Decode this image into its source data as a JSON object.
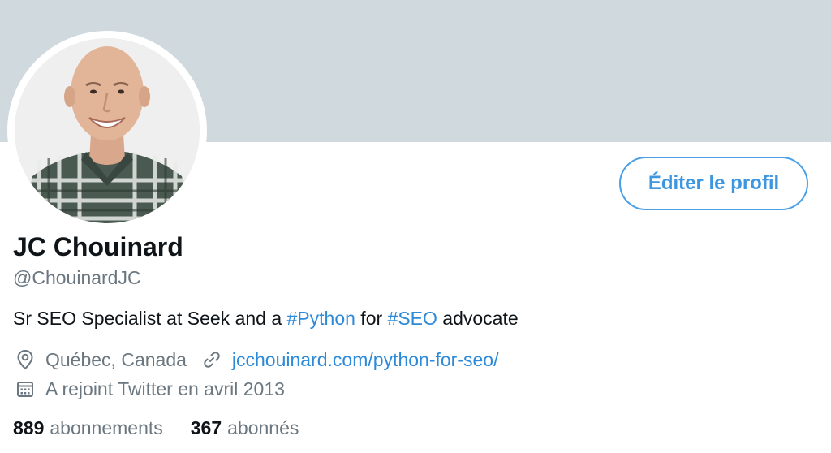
{
  "profile": {
    "name": "JC Chouinard",
    "handle": "@ChouinardJC",
    "edit_button_label": "Éditer le profil",
    "bio": {
      "part1": "Sr SEO Specialist at Seek and a ",
      "hashtag1": "#Python",
      "part2": " for ",
      "hashtag2": "#SEO",
      "part3": " advocate"
    },
    "location": "Québec, Canada",
    "website": "jcchouinard.com/python-for-seo/",
    "joined": "A rejoint Twitter en avril 2013",
    "following": {
      "count": "889",
      "label": "abonnements"
    },
    "followers": {
      "count": "367",
      "label": "abonnés"
    }
  },
  "icons": {
    "location": "location-pin-icon",
    "link": "link-icon",
    "calendar": "calendar-icon"
  },
  "colors": {
    "banner": "#cfd9de",
    "accent": "#2d8ad9",
    "secondary_text": "#6b7780",
    "primary_text": "#0f1419"
  }
}
